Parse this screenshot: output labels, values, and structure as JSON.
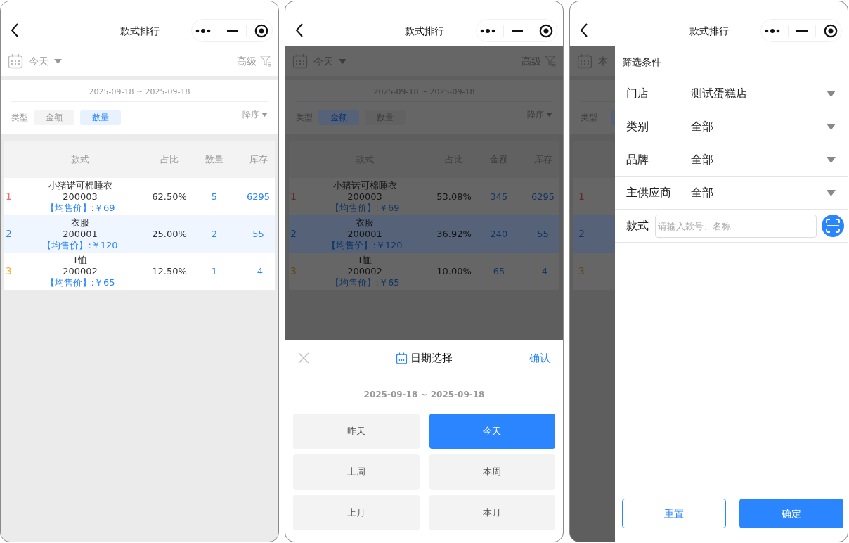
{
  "screens": [
    {
      "kind": "ranking",
      "nav": {
        "title": "款式排行"
      },
      "date_label": "今天",
      "advanced": "高级",
      "range": "2025-09-18 ~ 2025-09-18",
      "type_label": "类型",
      "type_options": [
        {
          "label": "金额",
          "selected": false
        },
        {
          "label": "数量",
          "selected": true
        }
      ],
      "sort": "降序",
      "table": {
        "columns": [
          "款式",
          "占比",
          "数量",
          "库存"
        ],
        "rows": [
          {
            "rank": "1",
            "color": "#f56c6c",
            "name": "小猪诺可棉睡衣",
            "code": "200003",
            "price": "【均售价】:￥69",
            "share": "62.50%",
            "value": "5",
            "stock": "6295",
            "selected": false
          },
          {
            "rank": "2",
            "color": "#2b85ff",
            "name": "衣服",
            "code": "200001",
            "price": "【均售价】:￥120",
            "share": "25.00%",
            "value": "2",
            "stock": "55",
            "selected": true
          },
          {
            "rank": "3",
            "color": "#f5b342",
            "name": "T恤",
            "code": "200002",
            "price": "【均售价】:￥65",
            "share": "12.50%",
            "value": "1",
            "stock": "-4",
            "selected": false
          }
        ]
      }
    },
    {
      "kind": "ranking",
      "nav": {
        "title": "款式排行"
      },
      "date_label": "今天",
      "advanced": "高级",
      "range": "2025-09-18 ~ 2025-09-18",
      "type_label": "类型",
      "type_options": [
        {
          "label": "金额",
          "selected": true
        },
        {
          "label": "数量",
          "selected": false
        }
      ],
      "sort": "降序",
      "table": {
        "columns": [
          "款式",
          "占比",
          "金额",
          "库存"
        ],
        "rows": [
          {
            "rank": "1",
            "color": "#622b2b",
            "name": "小猪诺可棉睡衣",
            "code": "200003",
            "price": "【均售价】:￥69",
            "share": "53.08%",
            "value": "345",
            "stock": "6295",
            "selected": false
          },
          {
            "rank": "2",
            "color": "#113566",
            "name": "衣服",
            "code": "200001",
            "price": "【均售价】:￥120",
            "share": "36.92%",
            "value": "240",
            "stock": "55",
            "selected": true
          },
          {
            "rank": "3",
            "color": "#62481a",
            "name": "T恤",
            "code": "200002",
            "price": "【均售价】:￥65",
            "share": "10.00%",
            "value": "65",
            "stock": "-4",
            "selected": false
          }
        ]
      },
      "sheet": {
        "title": "日期选择",
        "confirm": "确认",
        "range": "2025-09-18 ~ 2025-09-18",
        "options": [
          {
            "label": "昨天",
            "selected": false
          },
          {
            "label": "今天",
            "selected": true
          },
          {
            "label": "上周",
            "selected": false
          },
          {
            "label": "本周",
            "selected": false
          },
          {
            "label": "上月",
            "selected": false
          },
          {
            "label": "本月",
            "selected": false
          }
        ]
      }
    },
    {
      "kind": "filter",
      "nav": {
        "title": "款式排行"
      },
      "background": {
        "date_label": "本",
        "type_label": "类型",
        "type_chip": {
          "selected": true
        },
        "ranks": [
          {
            "rank": "1",
            "color": "#622b2b",
            "selected": false
          },
          {
            "rank": "2",
            "color": "#113566",
            "selected": true
          },
          {
            "rank": "3",
            "color": "#62481a",
            "selected": false
          }
        ]
      },
      "drawer": {
        "title": "筛选条件",
        "fields": [
          {
            "kind": "select",
            "label": "门店",
            "value": "测试蛋糕店"
          },
          {
            "kind": "select",
            "label": "类别",
            "value": "全部"
          },
          {
            "kind": "select",
            "label": "品牌",
            "value": "全部"
          },
          {
            "kind": "select",
            "label": "主供应商",
            "value": "全部"
          },
          {
            "kind": "search",
            "label": "款式",
            "placeholder": "请输入款号、名称"
          }
        ],
        "buttons": [
          {
            "kind": "outline",
            "label": "重置"
          },
          {
            "kind": "primary",
            "label": "确定"
          }
        ]
      }
    }
  ]
}
